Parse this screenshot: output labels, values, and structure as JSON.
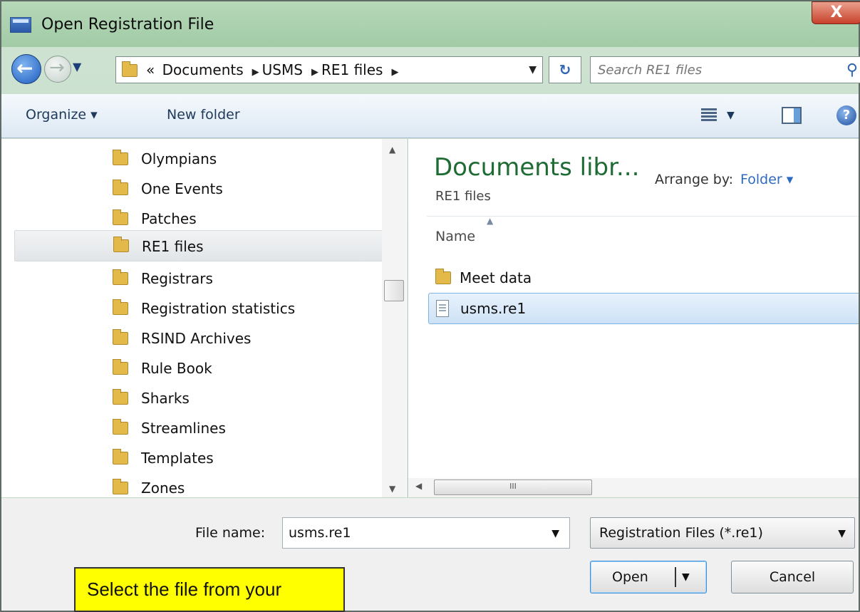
{
  "window": {
    "title": "Open Registration File",
    "close_label": "X"
  },
  "address_bar": {
    "prefix": "«",
    "crumbs": [
      "Documents",
      "USMS",
      "RE1 files"
    ],
    "search_placeholder": "Search RE1 files"
  },
  "toolbar": {
    "organize": "Organize ▾",
    "new_folder": "New folder"
  },
  "nav_items": [
    "Olympians",
    "One Events",
    "Patches",
    "RE1 files",
    "Registrars",
    "Registration statistics",
    "RSIND Archives",
    "Rule Book",
    "Sharks",
    "Streamlines",
    "Templates",
    "Zones"
  ],
  "nav_selected": "RE1 files",
  "content": {
    "library_title": "Documents libr...",
    "library_sub": "RE1 files",
    "arrange_label": "Arrange by:",
    "arrange_value": "Folder ▾",
    "column_name": "Name",
    "files": [
      {
        "name": "Meet data",
        "type": "folder"
      },
      {
        "name": "usms.re1",
        "type": "file",
        "selected": true
      }
    ],
    "hscroll_grip": "III"
  },
  "bottom": {
    "file_name_label": "File name:",
    "file_name_value": "usms.re1",
    "filter": "Registration Files (*.re1)",
    "open_label": "Open",
    "cancel_label": "Cancel"
  },
  "callout": {
    "text": "Select the file from your"
  }
}
